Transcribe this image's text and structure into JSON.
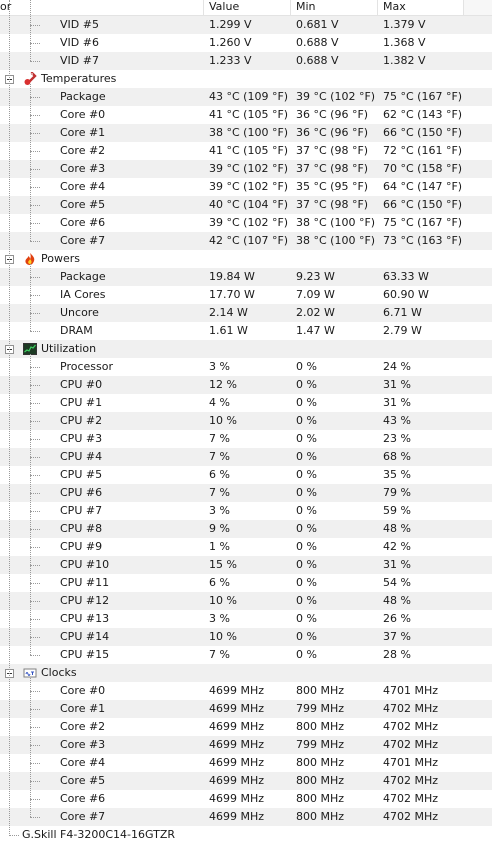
{
  "columns": {
    "sensor": "or",
    "value": "Value",
    "min": "Min",
    "max": "Max"
  },
  "vid_rows": [
    {
      "name": "VID #5",
      "value": "1.299 V",
      "min": "0.681 V",
      "max": "1.379 V"
    },
    {
      "name": "VID #6",
      "value": "1.260 V",
      "min": "0.688 V",
      "max": "1.368 V"
    },
    {
      "name": "VID #7",
      "value": "1.233 V",
      "min": "0.688 V",
      "max": "1.382 V"
    }
  ],
  "groups": [
    {
      "label": "Temperatures",
      "icon": "thermometer-icon",
      "rows": [
        {
          "name": "Package",
          "value": "43 °C  (109 °F)",
          "min": "39 °C  (102 °F)",
          "max": "75 °C  (167 °F)"
        },
        {
          "name": "Core #0",
          "value": "41 °C  (105 °F)",
          "min": "36 °C  (96 °F)",
          "max": "62 °C  (143 °F)"
        },
        {
          "name": "Core #1",
          "value": "38 °C  (100 °F)",
          "min": "36 °C  (96 °F)",
          "max": "66 °C  (150 °F)"
        },
        {
          "name": "Core #2",
          "value": "41 °C  (105 °F)",
          "min": "37 °C  (98 °F)",
          "max": "72 °C  (161 °F)"
        },
        {
          "name": "Core #3",
          "value": "39 °C  (102 °F)",
          "min": "37 °C  (98 °F)",
          "max": "70 °C  (158 °F)"
        },
        {
          "name": "Core #4",
          "value": "39 °C  (102 °F)",
          "min": "35 °C  (95 °F)",
          "max": "64 °C  (147 °F)"
        },
        {
          "name": "Core #5",
          "value": "40 °C  (104 °F)",
          "min": "37 °C  (98 °F)",
          "max": "66 °C  (150 °F)"
        },
        {
          "name": "Core #6",
          "value": "39 °C  (102 °F)",
          "min": "38 °C  (100 °F)",
          "max": "75 °C  (167 °F)"
        },
        {
          "name": "Core #7",
          "value": "42 °C  (107 °F)",
          "min": "38 °C  (100 °F)",
          "max": "73 °C  (163 °F)"
        }
      ]
    },
    {
      "label": "Powers",
      "icon": "flame-icon",
      "rows": [
        {
          "name": "Package",
          "value": "19.84 W",
          "min": "9.23 W",
          "max": "63.33 W"
        },
        {
          "name": "IA Cores",
          "value": "17.70 W",
          "min": "7.09 W",
          "max": "60.90 W"
        },
        {
          "name": "Uncore",
          "value": "2.14 W",
          "min": "2.02 W",
          "max": "6.71 W"
        },
        {
          "name": "DRAM",
          "value": "1.61 W",
          "min": "1.47 W",
          "max": "2.79 W"
        }
      ]
    },
    {
      "label": "Utilization",
      "icon": "utilization-graph-icon",
      "rows": [
        {
          "name": "Processor",
          "value": "3 %",
          "min": "0 %",
          "max": "24 %"
        },
        {
          "name": "CPU #0",
          "value": "12 %",
          "min": "0 %",
          "max": "31 %"
        },
        {
          "name": "CPU #1",
          "value": "4 %",
          "min": "0 %",
          "max": "31 %"
        },
        {
          "name": "CPU #2",
          "value": "10 %",
          "min": "0 %",
          "max": "43 %"
        },
        {
          "name": "CPU #3",
          "value": "7 %",
          "min": "0 %",
          "max": "23 %"
        },
        {
          "name": "CPU #4",
          "value": "7 %",
          "min": "0 %",
          "max": "68 %"
        },
        {
          "name": "CPU #5",
          "value": "6 %",
          "min": "0 %",
          "max": "35 %"
        },
        {
          "name": "CPU #6",
          "value": "7 %",
          "min": "0 %",
          "max": "79 %"
        },
        {
          "name": "CPU #7",
          "value": "3 %",
          "min": "0 %",
          "max": "59 %"
        },
        {
          "name": "CPU #8",
          "value": "9 %",
          "min": "0 %",
          "max": "48 %"
        },
        {
          "name": "CPU #9",
          "value": "1 %",
          "min": "0 %",
          "max": "42 %"
        },
        {
          "name": "CPU #10",
          "value": "15 %",
          "min": "0 %",
          "max": "31 %"
        },
        {
          "name": "CPU #11",
          "value": "6 %",
          "min": "0 %",
          "max": "54 %"
        },
        {
          "name": "CPU #12",
          "value": "10 %",
          "min": "0 %",
          "max": "48 %"
        },
        {
          "name": "CPU #13",
          "value": "3 %",
          "min": "0 %",
          "max": "26 %"
        },
        {
          "name": "CPU #14",
          "value": "10 %",
          "min": "0 %",
          "max": "37 %"
        },
        {
          "name": "CPU #15",
          "value": "7 %",
          "min": "0 %",
          "max": "28 %"
        }
      ]
    },
    {
      "label": "Clocks",
      "icon": "clock-chip-icon",
      "rows": [
        {
          "name": "Core #0",
          "value": "4699 MHz",
          "min": "800 MHz",
          "max": "4701 MHz"
        },
        {
          "name": "Core #1",
          "value": "4699 MHz",
          "min": "799 MHz",
          "max": "4702 MHz"
        },
        {
          "name": "Core #2",
          "value": "4699 MHz",
          "min": "800 MHz",
          "max": "4702 MHz"
        },
        {
          "name": "Core #3",
          "value": "4699 MHz",
          "min": "799 MHz",
          "max": "4702 MHz"
        },
        {
          "name": "Core #4",
          "value": "4699 MHz",
          "min": "800 MHz",
          "max": "4701 MHz"
        },
        {
          "name": "Core #5",
          "value": "4699 MHz",
          "min": "800 MHz",
          "max": "4702 MHz"
        },
        {
          "name": "Core #6",
          "value": "4699 MHz",
          "min": "800 MHz",
          "max": "4702 MHz"
        },
        {
          "name": "Core #7",
          "value": "4699 MHz",
          "min": "800 MHz",
          "max": "4702 MHz"
        }
      ]
    }
  ],
  "footer_partial": "G.Skill F4-3200C14-16GTZR",
  "colors": {
    "alt_row": "#f0f0f0",
    "tree_line": "#9a9a9a"
  }
}
